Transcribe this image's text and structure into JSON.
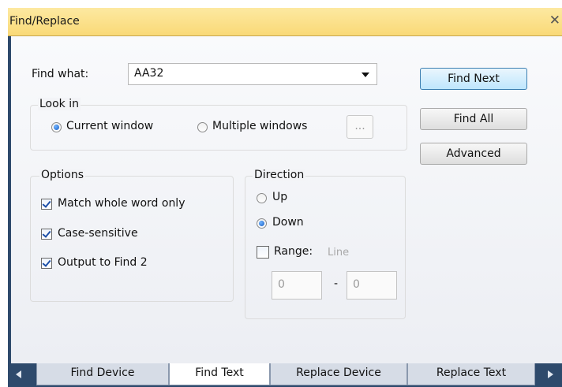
{
  "window": {
    "title": "Find/Replace",
    "close_glyph": "✕"
  },
  "find": {
    "label": "Find what:",
    "value": "AA32"
  },
  "look_in": {
    "legend": "Look in",
    "current_window": "Current window",
    "multiple_windows": "Multiple windows",
    "browse_label": "...",
    "selected": "Current window"
  },
  "options": {
    "legend": "Options",
    "items": [
      {
        "label": "Match whole word only",
        "checked": true
      },
      {
        "label": "Case-sensitive",
        "checked": true
      },
      {
        "label": "Output to Find 2",
        "checked": true
      }
    ]
  },
  "direction": {
    "legend": "Direction",
    "up": "Up",
    "down": "Down",
    "selected": "Down",
    "range_label": "Range:",
    "range_unit": "Line",
    "range_checked": false,
    "range_from": "0",
    "range_sep": "-",
    "range_to": "0"
  },
  "buttons": {
    "find_next": "Find Next",
    "find_all": "Find All",
    "advanced": "Advanced"
  },
  "tabs": [
    {
      "label": "Find Device",
      "active": false
    },
    {
      "label": "Find Text",
      "active": true
    },
    {
      "label": "Replace Device",
      "active": false
    },
    {
      "label": "Replace Text",
      "active": false
    }
  ],
  "colors": {
    "title_bar": "#f9d977",
    "frame": "#2e4a6c",
    "primary_button": "#bee6fd"
  }
}
